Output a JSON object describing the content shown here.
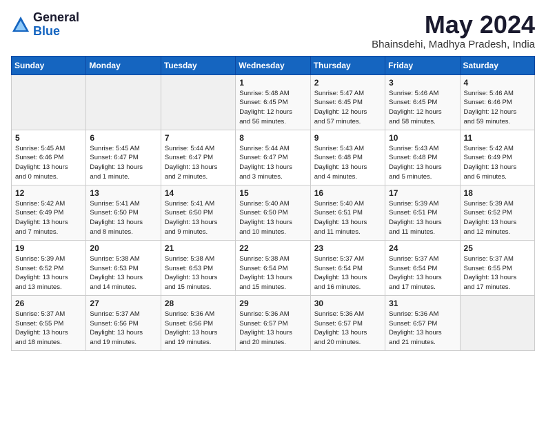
{
  "header": {
    "logo_general": "General",
    "logo_blue": "Blue",
    "title": "May 2024",
    "location": "Bhainsdehi, Madhya Pradesh, India"
  },
  "weekdays": [
    "Sunday",
    "Monday",
    "Tuesday",
    "Wednesday",
    "Thursday",
    "Friday",
    "Saturday"
  ],
  "weeks": [
    [
      {
        "day": "",
        "info": ""
      },
      {
        "day": "",
        "info": ""
      },
      {
        "day": "",
        "info": ""
      },
      {
        "day": "1",
        "info": "Sunrise: 5:48 AM\nSunset: 6:45 PM\nDaylight: 12 hours\nand 56 minutes."
      },
      {
        "day": "2",
        "info": "Sunrise: 5:47 AM\nSunset: 6:45 PM\nDaylight: 12 hours\nand 57 minutes."
      },
      {
        "day": "3",
        "info": "Sunrise: 5:46 AM\nSunset: 6:45 PM\nDaylight: 12 hours\nand 58 minutes."
      },
      {
        "day": "4",
        "info": "Sunrise: 5:46 AM\nSunset: 6:46 PM\nDaylight: 12 hours\nand 59 minutes."
      }
    ],
    [
      {
        "day": "5",
        "info": "Sunrise: 5:45 AM\nSunset: 6:46 PM\nDaylight: 13 hours\nand 0 minutes."
      },
      {
        "day": "6",
        "info": "Sunrise: 5:45 AM\nSunset: 6:47 PM\nDaylight: 13 hours\nand 1 minute."
      },
      {
        "day": "7",
        "info": "Sunrise: 5:44 AM\nSunset: 6:47 PM\nDaylight: 13 hours\nand 2 minutes."
      },
      {
        "day": "8",
        "info": "Sunrise: 5:44 AM\nSunset: 6:47 PM\nDaylight: 13 hours\nand 3 minutes."
      },
      {
        "day": "9",
        "info": "Sunrise: 5:43 AM\nSunset: 6:48 PM\nDaylight: 13 hours\nand 4 minutes."
      },
      {
        "day": "10",
        "info": "Sunrise: 5:43 AM\nSunset: 6:48 PM\nDaylight: 13 hours\nand 5 minutes."
      },
      {
        "day": "11",
        "info": "Sunrise: 5:42 AM\nSunset: 6:49 PM\nDaylight: 13 hours\nand 6 minutes."
      }
    ],
    [
      {
        "day": "12",
        "info": "Sunrise: 5:42 AM\nSunset: 6:49 PM\nDaylight: 13 hours\nand 7 minutes."
      },
      {
        "day": "13",
        "info": "Sunrise: 5:41 AM\nSunset: 6:50 PM\nDaylight: 13 hours\nand 8 minutes."
      },
      {
        "day": "14",
        "info": "Sunrise: 5:41 AM\nSunset: 6:50 PM\nDaylight: 13 hours\nand 9 minutes."
      },
      {
        "day": "15",
        "info": "Sunrise: 5:40 AM\nSunset: 6:50 PM\nDaylight: 13 hours\nand 10 minutes."
      },
      {
        "day": "16",
        "info": "Sunrise: 5:40 AM\nSunset: 6:51 PM\nDaylight: 13 hours\nand 11 minutes."
      },
      {
        "day": "17",
        "info": "Sunrise: 5:39 AM\nSunset: 6:51 PM\nDaylight: 13 hours\nand 11 minutes."
      },
      {
        "day": "18",
        "info": "Sunrise: 5:39 AM\nSunset: 6:52 PM\nDaylight: 13 hours\nand 12 minutes."
      }
    ],
    [
      {
        "day": "19",
        "info": "Sunrise: 5:39 AM\nSunset: 6:52 PM\nDaylight: 13 hours\nand 13 minutes."
      },
      {
        "day": "20",
        "info": "Sunrise: 5:38 AM\nSunset: 6:53 PM\nDaylight: 13 hours\nand 14 minutes."
      },
      {
        "day": "21",
        "info": "Sunrise: 5:38 AM\nSunset: 6:53 PM\nDaylight: 13 hours\nand 15 minutes."
      },
      {
        "day": "22",
        "info": "Sunrise: 5:38 AM\nSunset: 6:54 PM\nDaylight: 13 hours\nand 15 minutes."
      },
      {
        "day": "23",
        "info": "Sunrise: 5:37 AM\nSunset: 6:54 PM\nDaylight: 13 hours\nand 16 minutes."
      },
      {
        "day": "24",
        "info": "Sunrise: 5:37 AM\nSunset: 6:54 PM\nDaylight: 13 hours\nand 17 minutes."
      },
      {
        "day": "25",
        "info": "Sunrise: 5:37 AM\nSunset: 6:55 PM\nDaylight: 13 hours\nand 17 minutes."
      }
    ],
    [
      {
        "day": "26",
        "info": "Sunrise: 5:37 AM\nSunset: 6:55 PM\nDaylight: 13 hours\nand 18 minutes."
      },
      {
        "day": "27",
        "info": "Sunrise: 5:37 AM\nSunset: 6:56 PM\nDaylight: 13 hours\nand 19 minutes."
      },
      {
        "day": "28",
        "info": "Sunrise: 5:36 AM\nSunset: 6:56 PM\nDaylight: 13 hours\nand 19 minutes."
      },
      {
        "day": "29",
        "info": "Sunrise: 5:36 AM\nSunset: 6:57 PM\nDaylight: 13 hours\nand 20 minutes."
      },
      {
        "day": "30",
        "info": "Sunrise: 5:36 AM\nSunset: 6:57 PM\nDaylight: 13 hours\nand 20 minutes."
      },
      {
        "day": "31",
        "info": "Sunrise: 5:36 AM\nSunset: 6:57 PM\nDaylight: 13 hours\nand 21 minutes."
      },
      {
        "day": "",
        "info": ""
      }
    ]
  ]
}
